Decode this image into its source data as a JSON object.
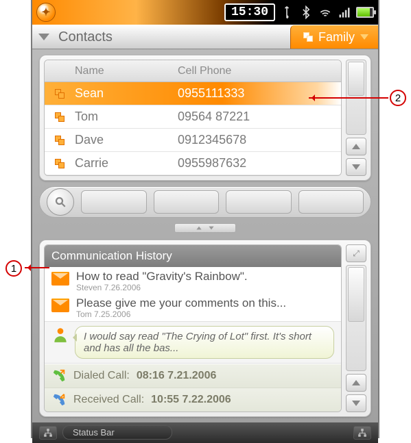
{
  "status": {
    "time": "15:30"
  },
  "header": {
    "title": "Contacts",
    "category": "Family"
  },
  "columns": {
    "name": "Name",
    "phone": "Cell Phone"
  },
  "contacts": [
    {
      "name": "Sean",
      "phone": "0955111333",
      "selected": true
    },
    {
      "name": "Tom",
      "phone": "09564 87221",
      "selected": false
    },
    {
      "name": "Dave",
      "phone": "0912345678",
      "selected": false
    },
    {
      "name": "Carrie",
      "phone": "0955987632",
      "selected": false
    }
  ],
  "history": {
    "title": "Communication History",
    "messages": [
      {
        "subject": "How to read \"Gravity's Rainbow\".",
        "meta": "Steven 7.26.2006"
      },
      {
        "subject": "Please give me your comments on this...",
        "meta": "Tom 7.25.2006"
      }
    ],
    "bubble": "I would say read \"The Crying of Lot\" first. It's short and has all the bas...",
    "calls": [
      {
        "label": "Dialed Call:",
        "time": "08:16 7.21.2006",
        "dir": "out"
      },
      {
        "label": "Received Call:",
        "time": "10:55 7.22.2006",
        "dir": "in"
      }
    ]
  },
  "bottom": {
    "label": "Status Bar"
  },
  "annotations": {
    "a1": "1",
    "a2": "2"
  }
}
